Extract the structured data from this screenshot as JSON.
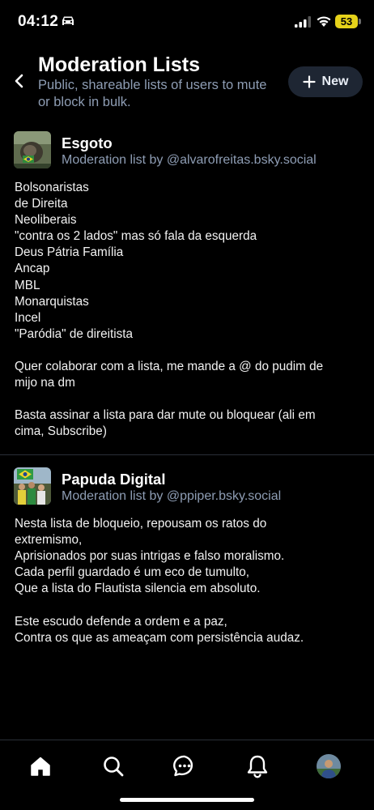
{
  "status_bar": {
    "time": "04:12",
    "battery": "53"
  },
  "header": {
    "title": "Moderation Lists",
    "subtitle": "Public, shareable lists of users to mute or block in bulk.",
    "new_button_label": "New"
  },
  "lists": [
    {
      "name": "Esgoto",
      "byline": "Moderation list by @alvarofreitas.bsky.social",
      "description_lines": [
        "Bolsonaristas",
        "de Direita",
        "Neoliberais",
        "\"contra os 2 lados\" mas só fala da esquerda",
        "Deus Pátria Família",
        "Ancap",
        "MBL",
        "Monarquistas",
        "Incel",
        "\"Paródia\" de direitista",
        "",
        "Quer colaborar com a lista, me mande a @ do pudim de",
        "mijo na dm",
        "",
        "Basta assinar a lista para dar mute ou bloquear (ali em",
        "cima, Subscribe)"
      ]
    },
    {
      "name": "Papuda Digital",
      "byline": "Moderation list by @ppiper.bsky.social",
      "description_lines": [
        "Nesta lista de bloqueio, repousam os ratos do",
        "extremismo,",
        "Aprisionados por suas intrigas e falso moralismo.",
        "Cada perfil guardado é um eco de tumulto,",
        "Que a lista do Flautista silencia em absoluto.",
        "",
        "Este escudo defende a ordem e a paz,",
        "Contra os que as ameaçam com persistência audaz."
      ]
    }
  ],
  "bottom_nav": {
    "items": [
      "home-icon",
      "search-icon",
      "chat-icon",
      "bell-icon",
      "profile-avatar"
    ]
  },
  "colors": {
    "background": "#000000",
    "muted_text": "#8e9db4",
    "button_bg": "#1e2633",
    "battery": "#e6d21a"
  }
}
